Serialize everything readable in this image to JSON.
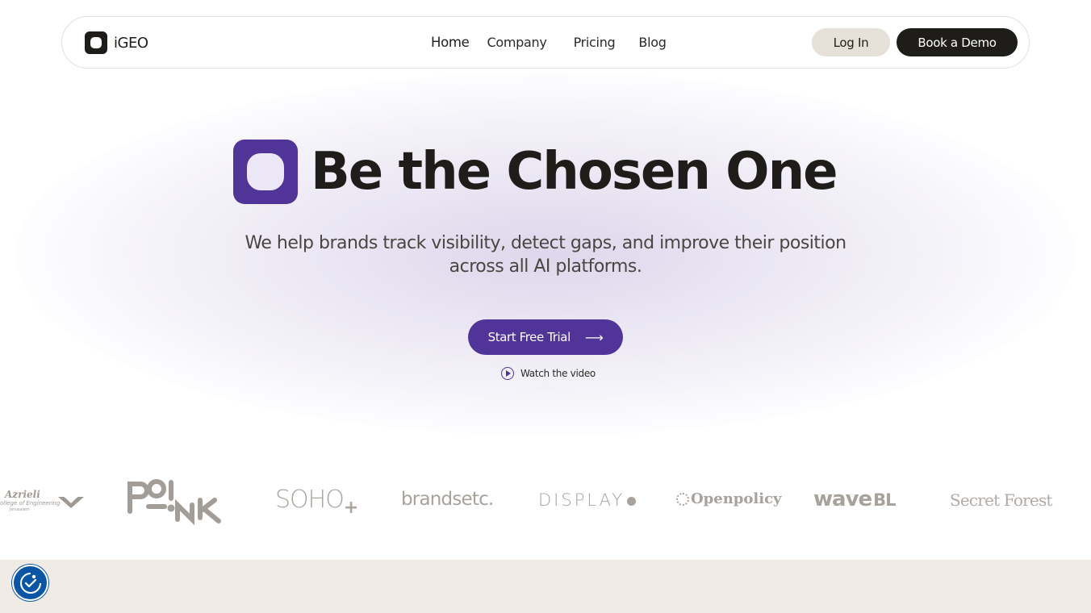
{
  "header": {
    "brand": "iGEO",
    "nav": [
      "Home",
      "Company",
      "Pricing",
      "Blog"
    ],
    "login_label": "Log In",
    "demo_label": "Book a Demo"
  },
  "hero": {
    "title": "Be the Chosen One",
    "subtitle": "We help brands track visibility, detect gaps, and improve their position across all AI platforms.",
    "cta_label": "Start Free Trial",
    "cta_arrow": "⟶",
    "watch_label": "Watch the video"
  },
  "logos": {
    "azrieli_name": "Azrieli",
    "azrieli_sub": "ollege of Engineering",
    "azrieli_sub2": "Jerusalem",
    "poink": "PO!NK",
    "soho": "SOHO",
    "soho_plus": "+",
    "brandsetc": "brandsetc.",
    "display": "DISPLAY",
    "openpolicy": "Openpolicy",
    "wave": "wave",
    "wave_bl": "BL",
    "secret_forest": "Secret Forest"
  },
  "colors": {
    "accent": "#503497",
    "dark": "#1f1d1a",
    "login_bg": "#e5e0d8",
    "band": "#f0ece5",
    "accessibility": "#0a56a5"
  },
  "icons": {
    "play": "play-circle-icon",
    "arrow": "arrow-right-icon",
    "accessibility": "accessibility-icon"
  }
}
